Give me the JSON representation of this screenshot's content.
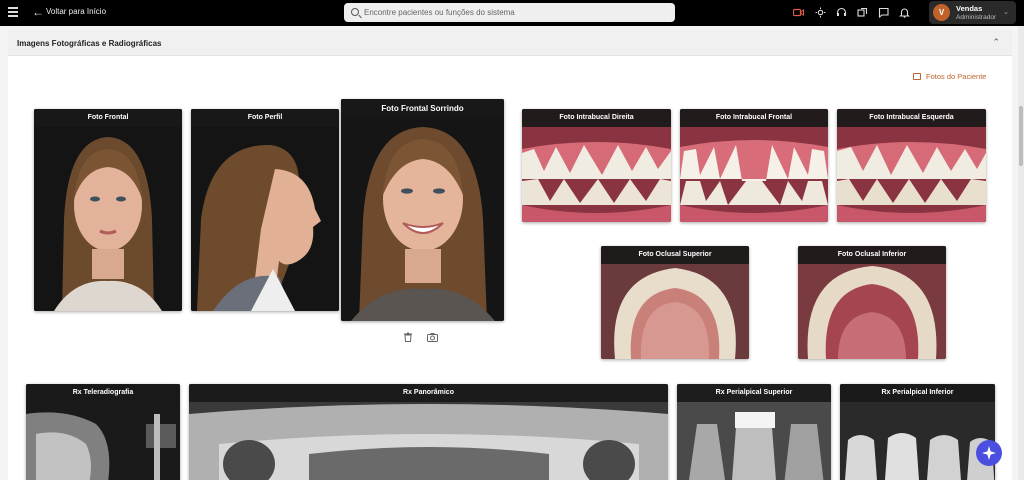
{
  "topbar": {
    "back_label": "Voltar para Início",
    "search_placeholder": "Encontre pacientes ou funções do sistema",
    "icons": [
      "video-icon",
      "brightness-icon",
      "headset-icon",
      "transfer-icon",
      "chat-icon",
      "bell-icon"
    ],
    "user": {
      "initial": "V",
      "name": "Vendas",
      "role": "Administrador"
    }
  },
  "section": {
    "title": "Imagens Fotográficas e Radiográficas",
    "fotos_link": "Fotos do Paciente"
  },
  "photos": {
    "frontal": "Foto Frontal",
    "perfil": "Foto Perfil",
    "frontal_sorrindo": "Foto Frontal Sorrindo",
    "intra_direita": "Foto Intrabucal Direita",
    "intra_frontal": "Foto Intrabucal Frontal",
    "intra_esquerda": "Foto Intrabucal Esquerda",
    "oclusal_superior": "Foto Oclusal Superior",
    "oclusal_inferior": "Foto Oclusal Inferior"
  },
  "radiographs": {
    "tele": "Rx Teleradiografia",
    "panoramico": "Rx Panorâmico",
    "periapical_superior": "Rx Perialpical Superior",
    "periapical_inferior": "Rx Perialpical Inferior"
  },
  "colors": {
    "accent": "#c0632a",
    "fab": "#4b4fe0"
  }
}
